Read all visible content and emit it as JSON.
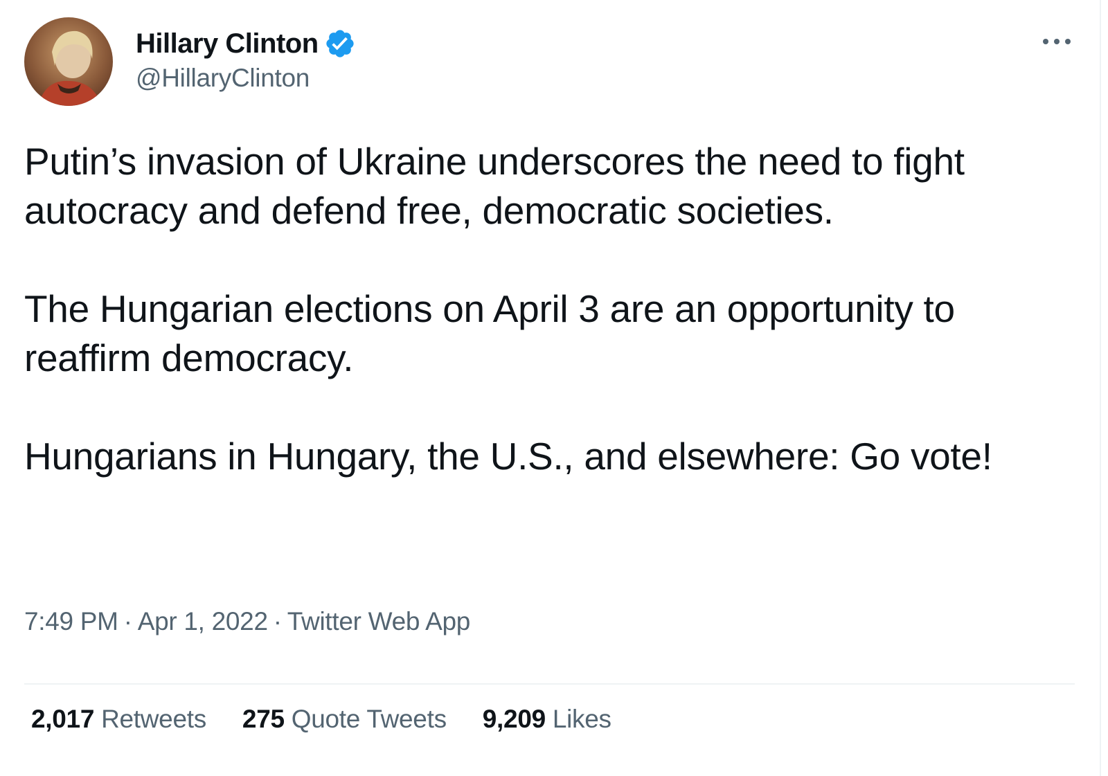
{
  "author": {
    "name": "Hillary Clinton",
    "handle": "@HillaryClinton",
    "verified": true
  },
  "tweet": {
    "paragraphs": [
      "Putin’s invasion of Ukraine underscores the need to fight autocracy and defend free, democratic societies.",
      "The Hungarian elections on April 3 are an opportunity to reaffirm democracy.",
      "Hungarians in Hungary, the U.S., and elsewhere: Go vote!"
    ],
    "time": "7:49 PM",
    "date": "Apr 1, 2022",
    "source": "Twitter Web App",
    "separator": "·"
  },
  "stats": {
    "retweets": {
      "count": "2,017",
      "label": "Retweets"
    },
    "quote_tweets": {
      "count": "275",
      "label": "Quote Tweets"
    },
    "likes": {
      "count": "9,209",
      "label": "Likes"
    }
  },
  "icons": {
    "verified": "verified-badge-icon",
    "more": "more-options-icon"
  },
  "colors": {
    "text_primary": "#0f1419",
    "text_secondary": "#536471",
    "verified_blue": "#1d9bf0",
    "divider": "#eff3f4"
  }
}
